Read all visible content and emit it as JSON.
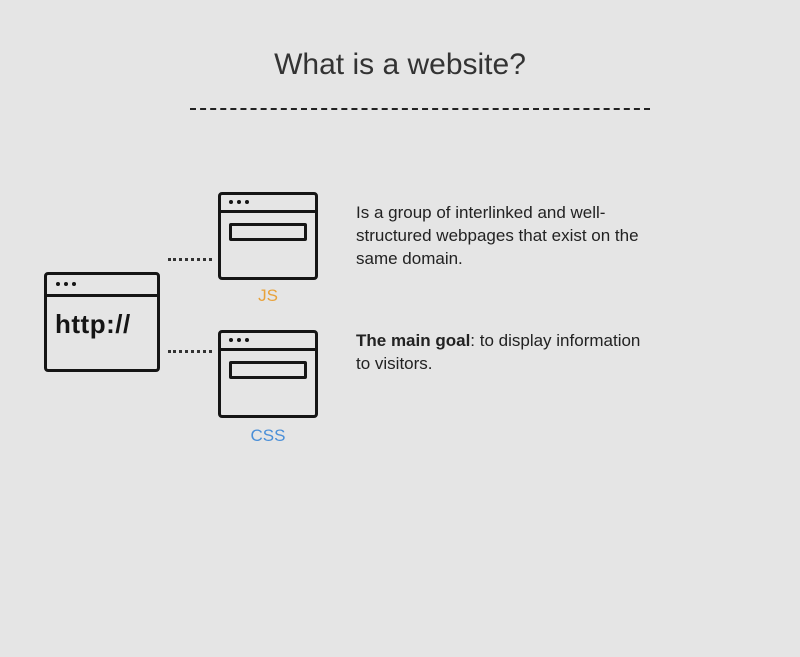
{
  "title": "What is a website?",
  "mainWindowText": "http://",
  "labels": {
    "js": "JS",
    "css": "CSS"
  },
  "paragraph1": "Is a group of interlinked and well-structured webpages that exist on the same domain.",
  "paragraph2": {
    "bold": "The main goal",
    "rest": ": to display information to visitors."
  }
}
